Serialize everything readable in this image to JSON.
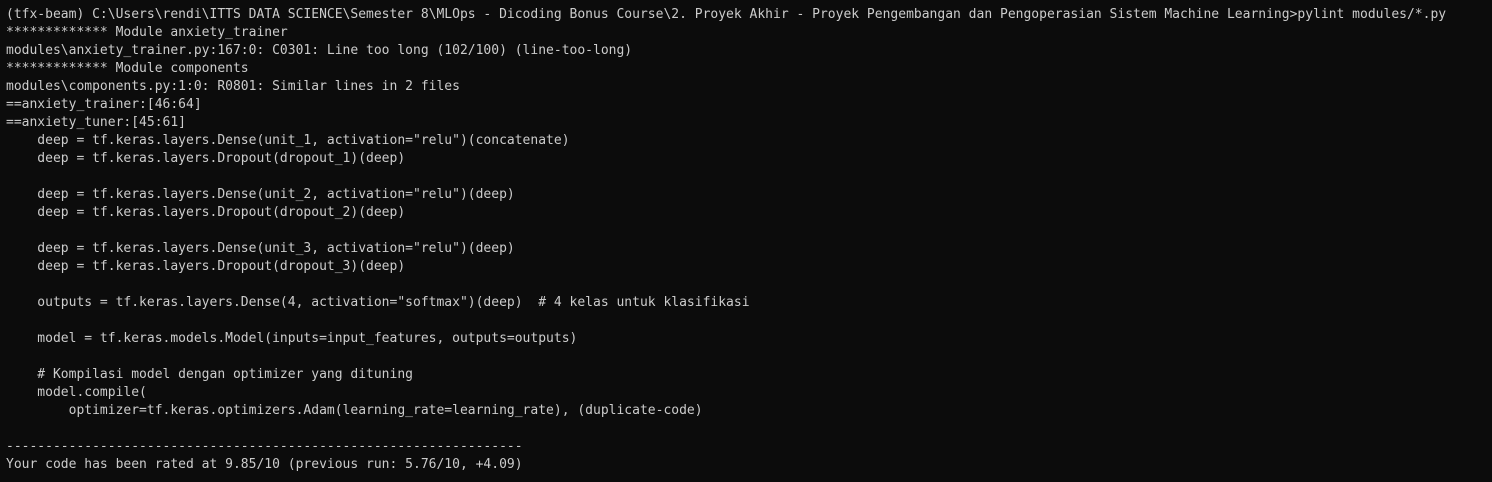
{
  "terminal": {
    "lines": [
      "(tfx-beam) C:\\Users\\rendi\\ITTS DATA SCIENCE\\Semester 8\\MLOps - Dicoding Bonus Course\\2. Proyek Akhir - Proyek Pengembangan dan Pengoperasian Sistem Machine Learning>pylint modules/*.py",
      "************* Module anxiety_trainer",
      "modules\\anxiety_trainer.py:167:0: C0301: Line too long (102/100) (line-too-long)",
      "************* Module components",
      "modules\\components.py:1:0: R0801: Similar lines in 2 files",
      "==anxiety_trainer:[46:64]",
      "==anxiety_tuner:[45:61]",
      "    deep = tf.keras.layers.Dense(unit_1, activation=\"relu\")(concatenate)",
      "    deep = tf.keras.layers.Dropout(dropout_1)(deep)",
      "",
      "    deep = tf.keras.layers.Dense(unit_2, activation=\"relu\")(deep)",
      "    deep = tf.keras.layers.Dropout(dropout_2)(deep)",
      "",
      "    deep = tf.keras.layers.Dense(unit_3, activation=\"relu\")(deep)",
      "    deep = tf.keras.layers.Dropout(dropout_3)(deep)",
      "",
      "    outputs = tf.keras.layers.Dense(4, activation=\"softmax\")(deep)  # 4 kelas untuk klasifikasi",
      "",
      "    model = tf.keras.models.Model(inputs=input_features, outputs=outputs)",
      "",
      "    # Kompilasi model dengan optimizer yang dituning",
      "    model.compile(",
      "        optimizer=tf.keras.optimizers.Adam(learning_rate=learning_rate), (duplicate-code)",
      "",
      "------------------------------------------------------------------",
      "Your code has been rated at 9.85/10 (previous run: 5.76/10, +4.09)"
    ]
  }
}
